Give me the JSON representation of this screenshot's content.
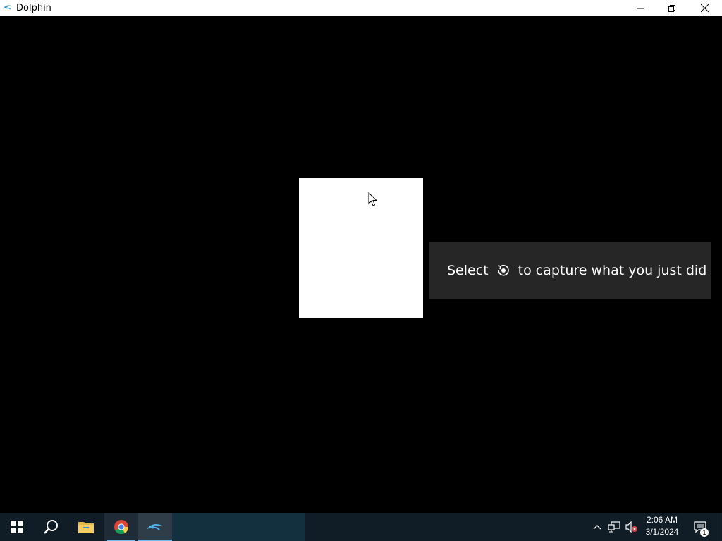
{
  "window": {
    "title": "Dolphin",
    "icon": "dolphin-icon"
  },
  "toast": {
    "prefix": "Select",
    "icon": "capture-icon",
    "suffix": "to capture what you just did"
  },
  "taskbar": {
    "items": [
      "start-icon",
      "search-icon",
      "file-explorer-icon",
      "chrome-icon",
      "dolphin-icon"
    ],
    "tray": {
      "time": "2:06 AM",
      "date": "3/1/2024",
      "notification_count": "1"
    }
  },
  "colors": {
    "taskbar_bg": "#101c26",
    "accent": "#76b9ed",
    "toast_bg": "#262626"
  }
}
